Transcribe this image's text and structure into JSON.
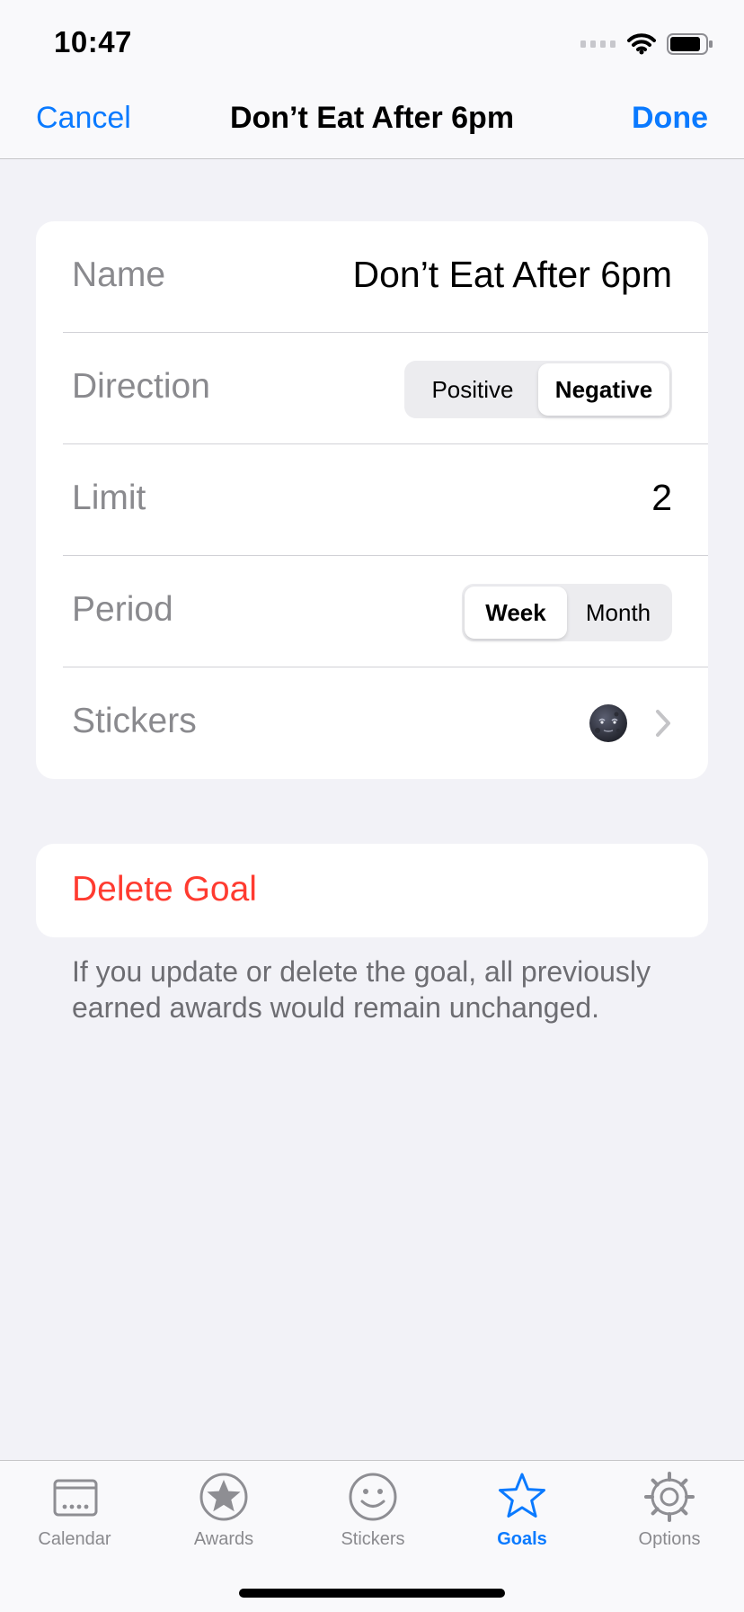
{
  "status_bar": {
    "time": "10:47"
  },
  "nav": {
    "cancel_label": "Cancel",
    "title": "Don’t Eat After 6pm",
    "done_label": "Done"
  },
  "form": {
    "name": {
      "label": "Name",
      "value": "Don’t Eat After 6pm"
    },
    "direction": {
      "label": "Direction",
      "options": [
        "Positive",
        "Negative"
      ],
      "selected": "Negative"
    },
    "limit": {
      "label": "Limit",
      "value": "2"
    },
    "period": {
      "label": "Period",
      "options": [
        "Week",
        "Month"
      ],
      "selected": "Week"
    },
    "stickers": {
      "label": "Stickers",
      "sticker_icon": "new-moon-face-emoji"
    }
  },
  "delete": {
    "label": "Delete Goal"
  },
  "footnote": "If you update or delete the goal, all previously earned awards would remain unchanged.",
  "tab_bar": {
    "items": [
      {
        "label": "Calendar",
        "icon": "calendar-icon"
      },
      {
        "label": "Awards",
        "icon": "award-star-icon"
      },
      {
        "label": "Stickers",
        "icon": "smiley-icon"
      },
      {
        "label": "Goals",
        "icon": "star-outline-icon",
        "active": true
      },
      {
        "label": "Options",
        "icon": "gear-icon"
      }
    ]
  },
  "colors": {
    "accent": "#0a7aff",
    "destructive": "#ff3b30",
    "background": "#f2f2f7",
    "secondary_text": "#8a8a8e"
  }
}
